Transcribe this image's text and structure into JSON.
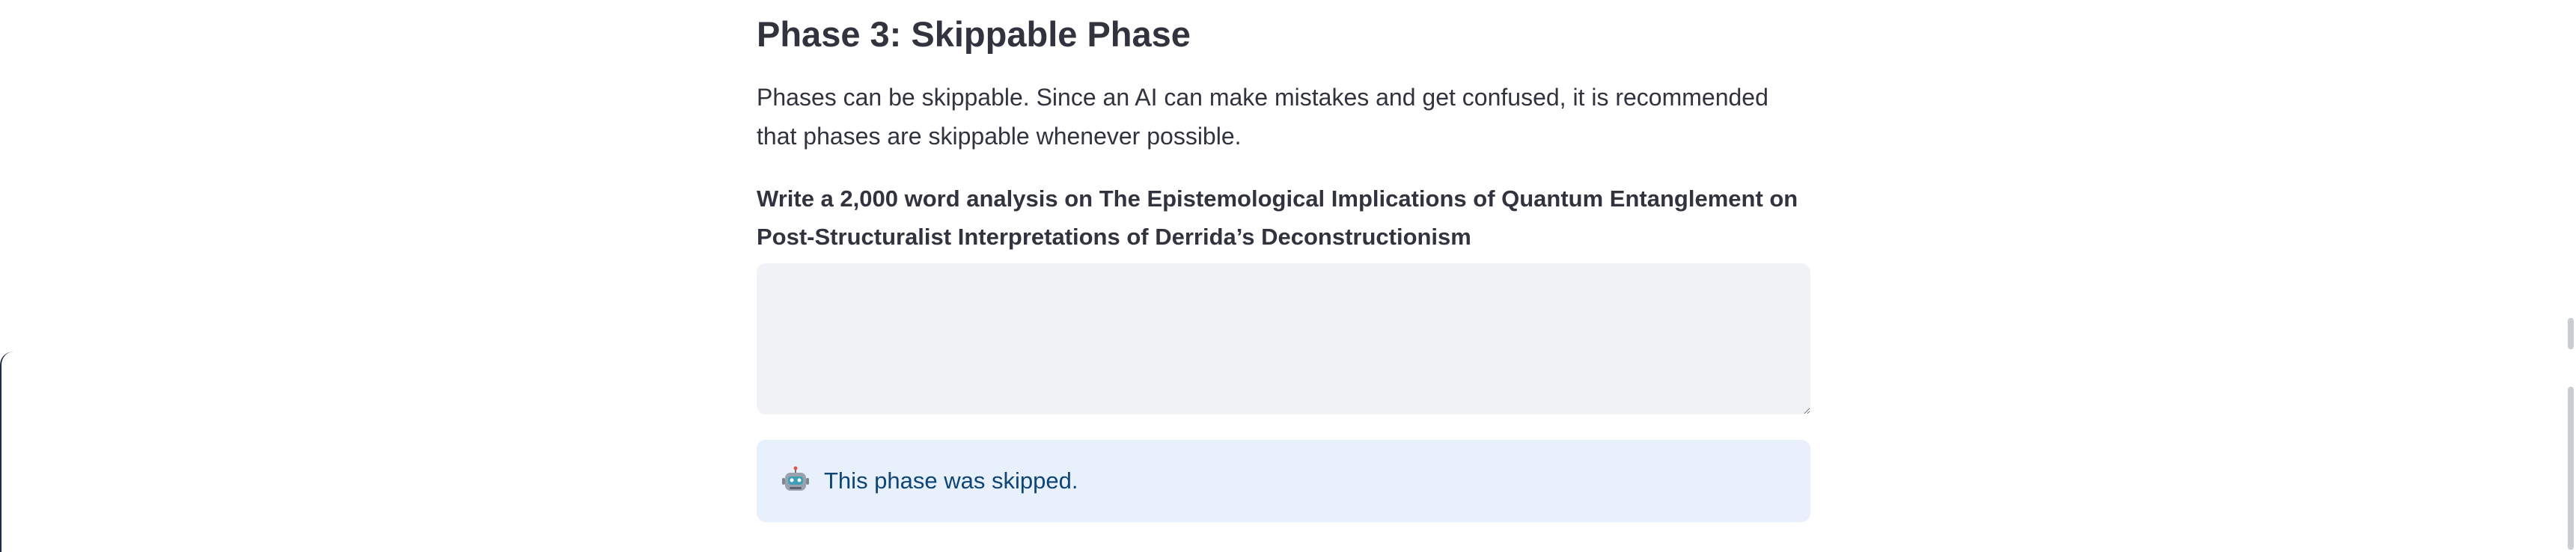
{
  "phase": {
    "heading": "Phase 3: Skippable Phase",
    "description": "Phases can be skippable. Since an AI can make mistakes and get confused, it is recommended that phases are skippable whenever possible.",
    "prompt_label": "Write a 2,000 word analysis on The Epistemological Implications of Quantum Entanglement on Post-Structuralist Interpretations of Derrida’s Deconstructionism",
    "answer_value": "",
    "status_message": "This phase was skipped.",
    "status_icon": "robot-icon"
  },
  "colors": {
    "text": "#31333f",
    "textarea_bg": "#f0f2f6",
    "alert_bg": "#e8f0fb",
    "alert_text": "#0e4578"
  }
}
